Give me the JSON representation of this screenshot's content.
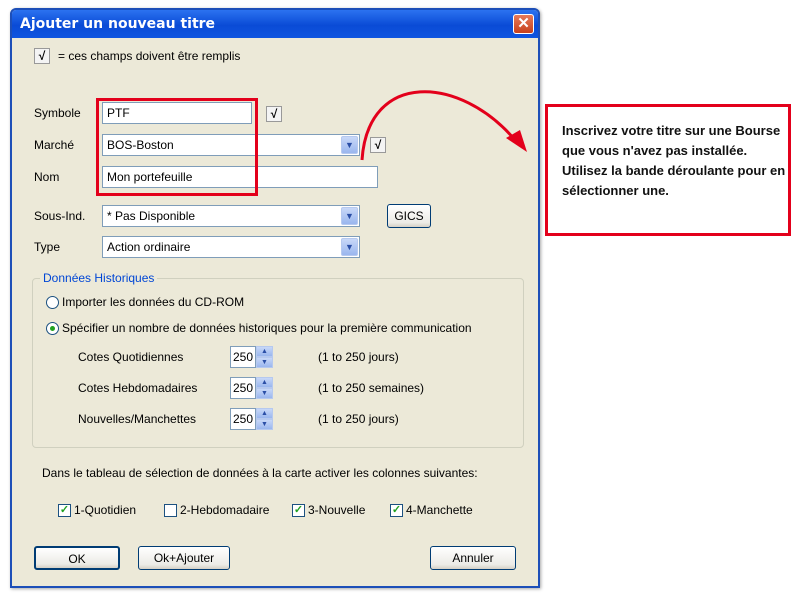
{
  "dialog": {
    "title": "Ajouter un nouveau titre",
    "close_glyph": "✕",
    "required_legend": "= ces champs doivent être remplis",
    "required_mark": "√"
  },
  "form": {
    "symbol_label": "Symbole",
    "symbol_value": "PTF",
    "market_label": "Marché",
    "market_value": "BOS-Boston",
    "name_label": "Nom",
    "name_value": "Mon portefeuille",
    "subind_label": "Sous-Ind.",
    "subind_value": "* Pas Disponible",
    "gics_button": "GICS",
    "type_label": "Type",
    "type_value": "Action ordinaire"
  },
  "historical": {
    "group_title": "Données Historiques",
    "option_import": "Importer les données du CD-ROM",
    "option_specify": "Spécifier un nombre de données historiques pour la première communication",
    "selected_option": "specify",
    "rows": [
      {
        "label": "Cotes Quotidiennes",
        "value": "250",
        "range": "(1 to 250 jours)"
      },
      {
        "label": "Cotes Hebdomadaires",
        "value": "250",
        "range": "(1 to 250 semaines)"
      },
      {
        "label": "Nouvelles/Manchettes",
        "value": "250",
        "range": "(1 to 250 jours)"
      }
    ]
  },
  "columns": {
    "instruction": "Dans le tableau de sélection de données à la carte activer les colonnes suivantes:",
    "items": [
      {
        "label": "1-Quotidien",
        "checked": true
      },
      {
        "label": "2-Hebdomadaire",
        "checked": false
      },
      {
        "label": "3-Nouvelle",
        "checked": true
      },
      {
        "label": "4-Manchette",
        "checked": true
      }
    ]
  },
  "buttons": {
    "ok": "OK",
    "ok_add": "Ok+Ajouter",
    "cancel": "Annuler"
  },
  "annotation": {
    "text": "Inscrivez votre titre sur une Bourse que vous n'avez pas installée. Utilisez la bande déroulante pour en sélectionner une.",
    "color": "#e3001b"
  },
  "colors": {
    "titlebar": "#0a4bd6",
    "dialog_bg": "#ece9d8",
    "group_title": "#0046d5",
    "check_green": "#21a121"
  }
}
